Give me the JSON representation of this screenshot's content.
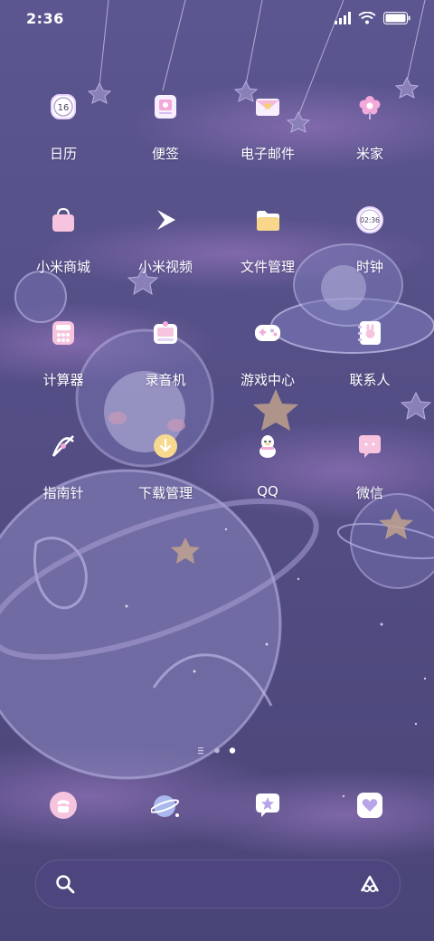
{
  "status_bar": {
    "time": "2:36"
  },
  "apps": [
    {
      "label": "日历",
      "icon": "calendar-icon",
      "badge": "16"
    },
    {
      "label": "便签",
      "icon": "notes-icon"
    },
    {
      "label": "电子邮件",
      "icon": "mail-icon"
    },
    {
      "label": "米家",
      "icon": "flower-icon"
    },
    {
      "label": "小米商城",
      "icon": "shopping-bag-icon"
    },
    {
      "label": "小米视频",
      "icon": "video-play-icon"
    },
    {
      "label": "文件管理",
      "icon": "folder-icon"
    },
    {
      "label": "时钟",
      "icon": "clock-icon",
      "badge": "02:36"
    },
    {
      "label": "计算器",
      "icon": "calculator-icon"
    },
    {
      "label": "录音机",
      "icon": "recorder-icon"
    },
    {
      "label": "游戏中心",
      "icon": "gamepad-icon"
    },
    {
      "label": "联系人",
      "icon": "contacts-icon"
    },
    {
      "label": "指南针",
      "icon": "compass-icon"
    },
    {
      "label": "下载管理",
      "icon": "download-icon"
    },
    {
      "label": "QQ",
      "icon": "qq-penguin-icon"
    },
    {
      "label": "微信",
      "icon": "chat-bubble-icon"
    }
  ],
  "dock": [
    {
      "icon": "phone-icon"
    },
    {
      "icon": "planet-browser-icon"
    },
    {
      "icon": "message-star-icon"
    },
    {
      "icon": "gallery-heart-icon"
    }
  ],
  "page_indicator": {
    "pages": 3,
    "current": 3
  },
  "search_bar": {
    "left_icon": "search-icon",
    "right_icon": "voice-assistant-icon"
  }
}
